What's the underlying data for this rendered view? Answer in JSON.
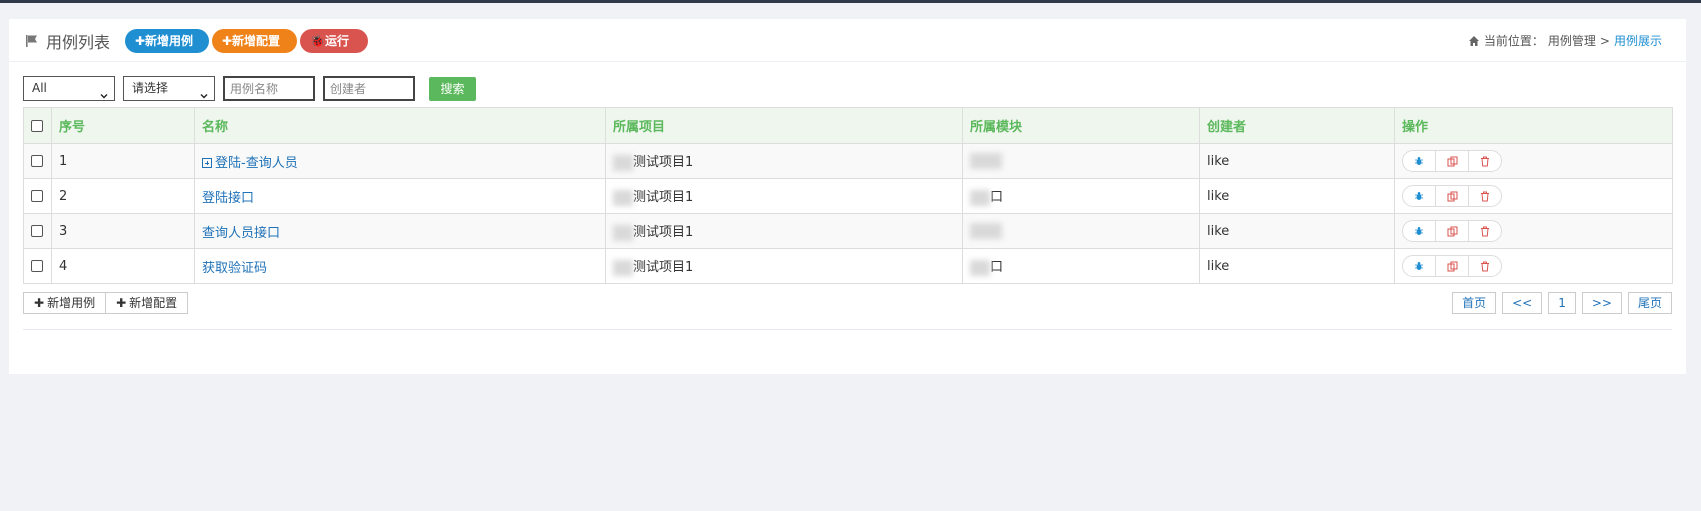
{
  "header": {
    "title": "用例列表",
    "btn_add_case": "✚新增用例",
    "btn_add_config": "✚新增配置",
    "btn_run": "🐞运行"
  },
  "breadcrumb": {
    "label": "当前位置：",
    "section": "用例管理",
    "separator": ">",
    "current": "用例展示"
  },
  "filters": {
    "project_select": "All",
    "module_select": "请选择",
    "name_placeholder": "用例名称",
    "creator_placeholder": "创建者",
    "search_label": "搜索"
  },
  "table": {
    "headers": [
      "序号",
      "名称",
      "所属项目",
      "所属模块",
      "创建者",
      "操作"
    ],
    "rows": [
      {
        "index": "1",
        "name": "登陆-查询人员",
        "project": "测试项目1",
        "module": "",
        "creator": "like"
      },
      {
        "index": "2",
        "name": "登陆接口",
        "project": "测试项目1",
        "module": "口",
        "creator": "like"
      },
      {
        "index": "3",
        "name": "查询人员接口",
        "project": "测试项目1",
        "module": "",
        "creator": "like"
      },
      {
        "index": "4",
        "name": "获取验证码",
        "project": "测试项目1",
        "module": "口",
        "creator": "like"
      }
    ]
  },
  "footer": {
    "add_case": "新增用例",
    "add_config": "新增配置",
    "first": "首页",
    "prev": "<<",
    "page": "1",
    "next": ">>",
    "last": "尾页"
  },
  "colors": {
    "accent_blue": "#1f8fd2",
    "accent_orange": "#f0821a",
    "accent_red": "#d9534f",
    "header_green": "#5cb85c"
  },
  "icons": {
    "title": "flag-icon",
    "breadcrumb": "home-icon",
    "ops": [
      "bug-icon",
      "copy-icon",
      "trash-icon"
    ]
  }
}
